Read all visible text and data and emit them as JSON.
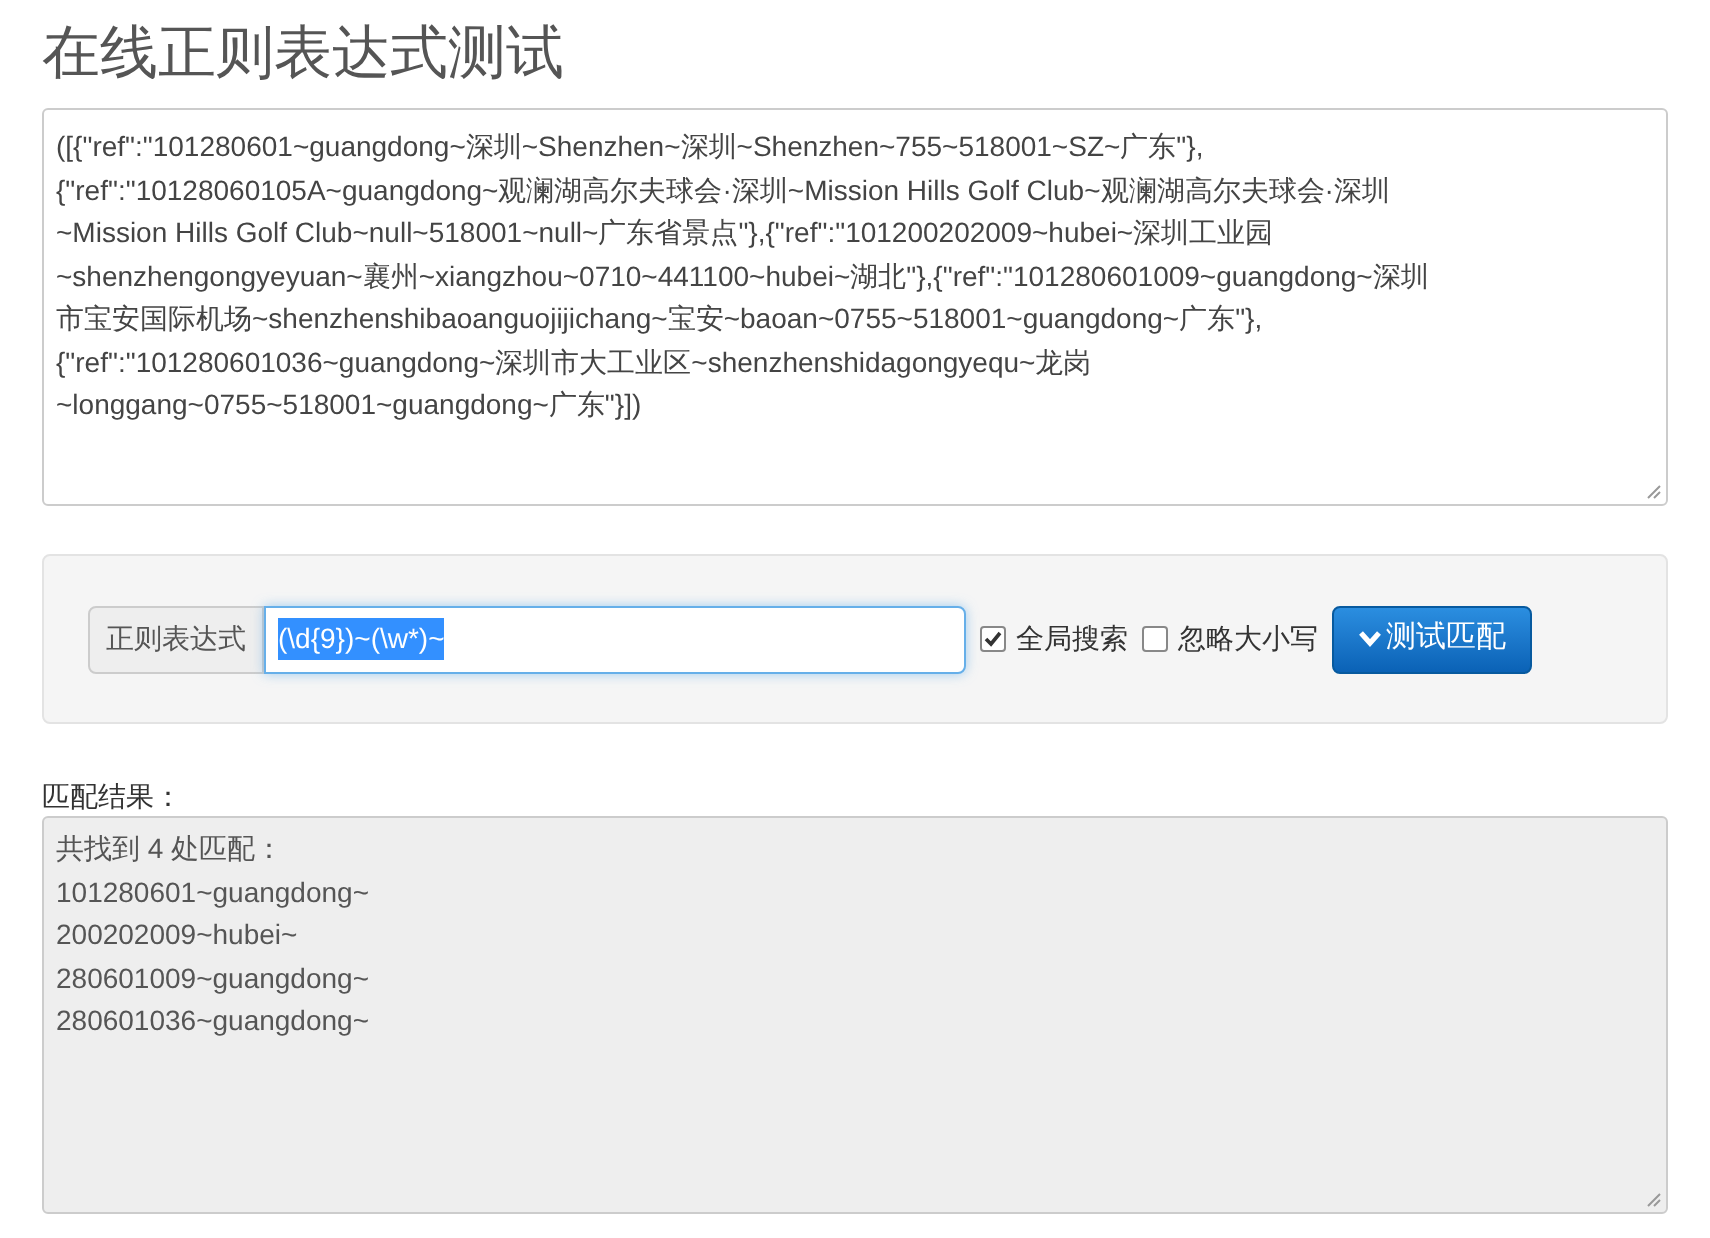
{
  "title": "在线正则表达式测试",
  "source": {
    "lines": [
      "([{\"ref\":\"101280601~guangdong~深圳~Shenzhen~深圳~Shenzhen~755~518001~SZ~广东\"},",
      "{\"ref\":\"10128060105A~guangdong~观澜湖高尔夫球会·深圳~Mission Hills Golf Club~观澜湖高尔夫球会·深圳",
      "~Mission Hills Golf Club~null~518001~null~广东省景点\"},{\"ref\":\"101200202009~hubei~深圳工业园",
      "~shenzhengongyeyuan~襄州~xiangzhou~0710~441100~hubei~湖北\"},{\"ref\":\"101280601009~guangdong~深圳",
      "市宝安国际机场~shenzhenshibaoanguojijichang~宝安~baoan~0755~518001~guangdong~广东\"},",
      "{\"ref\":\"101280601036~guangdong~深圳市大工业区~shenzhenshidagongyequ~龙岗",
      "~longgang~0755~518001~guangdong~广东\"}])"
    ]
  },
  "form": {
    "addon": "正则表达式",
    "pattern": "(\\d{9})~(\\w*)~",
    "pattern_selected": true,
    "options": [
      {
        "label": "全局搜索",
        "checked": true
      },
      {
        "label": "忽略大小写",
        "checked": false
      }
    ],
    "button": {
      "label": "测试匹配"
    }
  },
  "result": {
    "label": "匹配结果：",
    "lines": [
      "共找到 4 处匹配：",
      "101280601~guangdong~",
      "200202009~hubei~",
      "280601009~guangdong~",
      "280601036~guangdong~"
    ]
  }
}
